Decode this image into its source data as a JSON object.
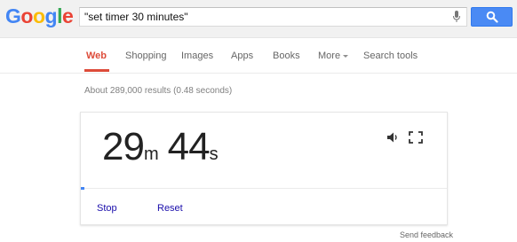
{
  "logo": {
    "letters": [
      "G",
      "o",
      "o",
      "g",
      "l",
      "e"
    ],
    "colors": [
      "#4285f4",
      "#ea4335",
      "#fbbc05",
      "#4285f4",
      "#34a853",
      "#ea4335"
    ]
  },
  "search": {
    "query": "\"set timer 30 minutes\"",
    "accent_color": "#4a8af4"
  },
  "tabs": [
    {
      "label": "Web",
      "active": true
    },
    {
      "label": "Shopping",
      "active": false
    },
    {
      "label": "Images",
      "active": false
    },
    {
      "label": "Apps",
      "active": false
    },
    {
      "label": "Books",
      "active": false
    },
    {
      "label": "More",
      "active": false
    },
    {
      "label": "Search tools",
      "active": false
    }
  ],
  "results_stats": "About 289,000 results (0.48 seconds)",
  "timer": {
    "minutes": "29",
    "minutes_unit": "m",
    "seconds": "44",
    "seconds_unit": "s",
    "progress_fraction": 0.01
  },
  "controls": {
    "stop_label": "Stop",
    "reset_label": "Reset"
  },
  "footer": {
    "feedback_label": "Send feedback"
  },
  "icons": [
    "mic-icon",
    "search-icon",
    "speaker-icon",
    "fullscreen-icon"
  ]
}
